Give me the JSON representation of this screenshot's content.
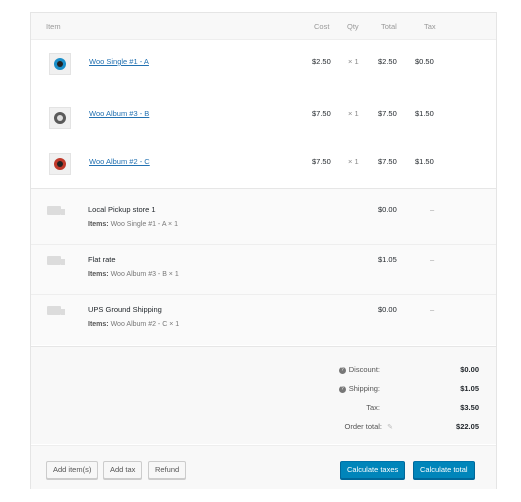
{
  "header": {
    "item": "Item",
    "cost": "Cost",
    "qty": "Qty",
    "total": "Total",
    "tax": "Tax"
  },
  "items": [
    {
      "name": "Woo Single #1 - A",
      "cost": "$2.50",
      "qty": "× 1",
      "total": "$2.50",
      "tax": "$0.50",
      "disc_color": "#1b8fc9"
    },
    {
      "name": "Woo Album #3 - B",
      "cost": "$7.50",
      "qty": "× 1",
      "total": "$7.50",
      "tax": "$1.50",
      "disc_color": "#5a5a5a"
    },
    {
      "name": "Woo Album #2 - C",
      "cost": "$7.50",
      "qty": "× 1",
      "total": "$7.50",
      "tax": "$1.50",
      "disc_color": "#c0392b"
    }
  ],
  "shipping": [
    {
      "name": "Local Pickup store 1",
      "items_label": "Items:",
      "items": "Woo Single #1 - A × 1",
      "total": "$0.00",
      "tax": "–"
    },
    {
      "name": "Flat rate",
      "items_label": "Items:",
      "items": "Woo Album #3 - B × 1",
      "total": "$1.05",
      "tax": "–"
    },
    {
      "name": "UPS Ground Shipping",
      "items_label": "Items:",
      "items": "Woo Album #2 - C × 1",
      "total": "$0.00",
      "tax": "–"
    }
  ],
  "totals": {
    "discount_label": "Discount:",
    "discount": "$0.00",
    "shipping_label": "Shipping:",
    "shipping": "$1.05",
    "tax_label": "Tax:",
    "tax": "$3.50",
    "order_total_label": "Order total:",
    "order_total": "$22.05"
  },
  "buttons": {
    "add_items": "Add item(s)",
    "add_tax": "Add tax",
    "refund": "Refund",
    "calculate_taxes": "Calculate taxes",
    "calculate_total": "Calculate total"
  },
  "colors": {
    "primary": "#0085ba",
    "link": "#2271b1"
  }
}
